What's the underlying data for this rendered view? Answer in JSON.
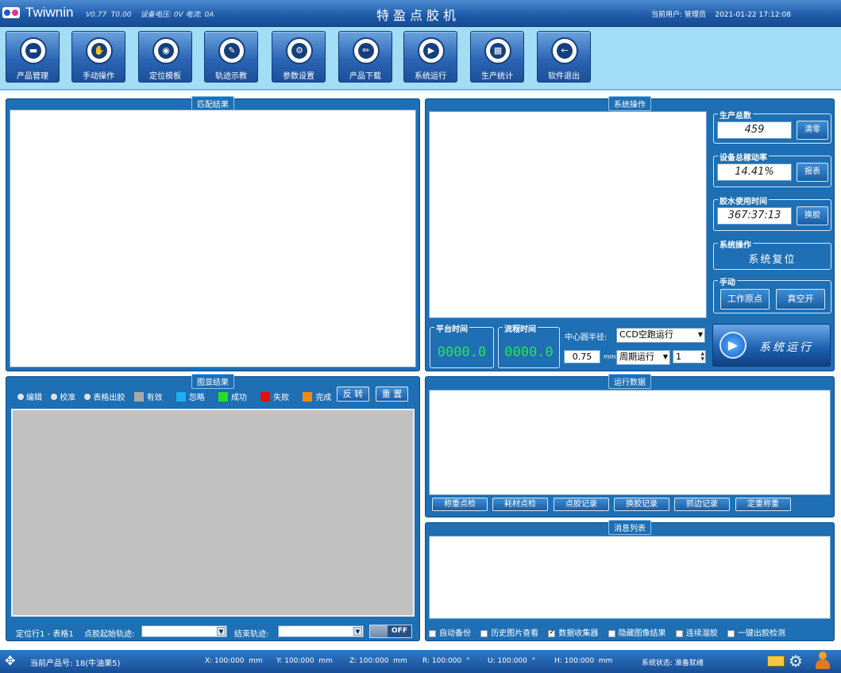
{
  "titlebar": {
    "brand": "Twiwnin",
    "version": "V0.77  T0.00",
    "device_status": "设备电压: 0V 电流: 0A",
    "app_title": "特盈点胶机",
    "current_user": "当前用户: 管理员",
    "datetime": "2021-01-22 17:12:08"
  },
  "toolbar": {
    "buttons": [
      {
        "label": "产品管理",
        "icon": "folder-icon"
      },
      {
        "label": "手动操作",
        "icon": "hand-icon"
      },
      {
        "label": "定位模板",
        "icon": "camera-icon"
      },
      {
        "label": "轨迹示教",
        "icon": "edit-icon"
      },
      {
        "label": "参数设置",
        "icon": "gear-icon"
      },
      {
        "label": "产品下载",
        "icon": "pencil-icon"
      },
      {
        "label": "系统运行",
        "icon": "play-icon"
      },
      {
        "label": "生产统计",
        "icon": "calendar-icon"
      },
      {
        "label": "软件退出",
        "icon": "exit-icon"
      }
    ]
  },
  "match_panel": {
    "title": "匹配结果"
  },
  "system_panel": {
    "title": "系统操作",
    "production_total": {
      "title": "生产总数",
      "value": "459",
      "button": "清零"
    },
    "oee": {
      "title": "设备总稼动率",
      "value": "14.41%",
      "button": "报表"
    },
    "glue_time": {
      "title": "胶水使用时间",
      "value": "367:37:13",
      "button": "换胶"
    },
    "sys_op": {
      "title": "系统操作",
      "button": "系统复位"
    },
    "manual": {
      "title": "手动",
      "btn_home": "工作原点",
      "btn_vacuum": "真空开"
    },
    "platform_time": {
      "title": "平台时间",
      "value": "0000.0"
    },
    "flow_time": {
      "title": "流程时间",
      "value": "0000.0"
    },
    "radius_label": "中心圆半径:",
    "radius_value": "0.75",
    "radius_unit": "mm",
    "mode_select": "CCD空跑运行",
    "cycle_select": "周期运行",
    "count_value": "1",
    "run_button": "系统运行"
  },
  "graph_panel": {
    "title": "图显结果",
    "radios": [
      "编辑",
      "校准",
      "表格出胶"
    ],
    "legend": [
      {
        "label": "有效",
        "color": "#a8a8a8"
      },
      {
        "label": "忽略",
        "color": "#1ab0f0"
      },
      {
        "label": "成功",
        "color": "#22e022"
      },
      {
        "label": "失败",
        "color": "#e01010"
      },
      {
        "label": "完成",
        "color": "#f08a10"
      }
    ],
    "btn_invert": "反 转",
    "btn_reset": "重 置",
    "location_text": "定位行1 - 表格1",
    "start_track_label": "点胶起始轨迹:",
    "end_track_label": "结束轨迹:",
    "toggle_text": "OFF"
  },
  "run_data_panel": {
    "title": "运行数据",
    "buttons": [
      "称重点检",
      "耗材点检",
      "点胶记录",
      "换胶记录",
      "抓边记录",
      "定重称重"
    ]
  },
  "message_panel": {
    "title": "消息列表",
    "checks": [
      {
        "label": "自动备份",
        "checked": false
      },
      {
        "label": "历史图片查看",
        "checked": false
      },
      {
        "label": "数据收集器",
        "checked": true
      },
      {
        "label": "隐藏图像结果",
        "checked": false
      },
      {
        "label": "连续溜胶",
        "checked": false
      },
      {
        "label": "一键出胶检测",
        "checked": false
      }
    ]
  },
  "statusbar": {
    "product": "当前产品号: 18(牛油果5)",
    "x": "X: 100:000  mm",
    "y": "Y: 100:000  mm",
    "z": "Z: 100:000  mm",
    "r": "R: 100:000  °",
    "u": "U: 100:000  °",
    "h": "H: 100:000  mm",
    "system_status": "系统状态: 准备就绪"
  }
}
